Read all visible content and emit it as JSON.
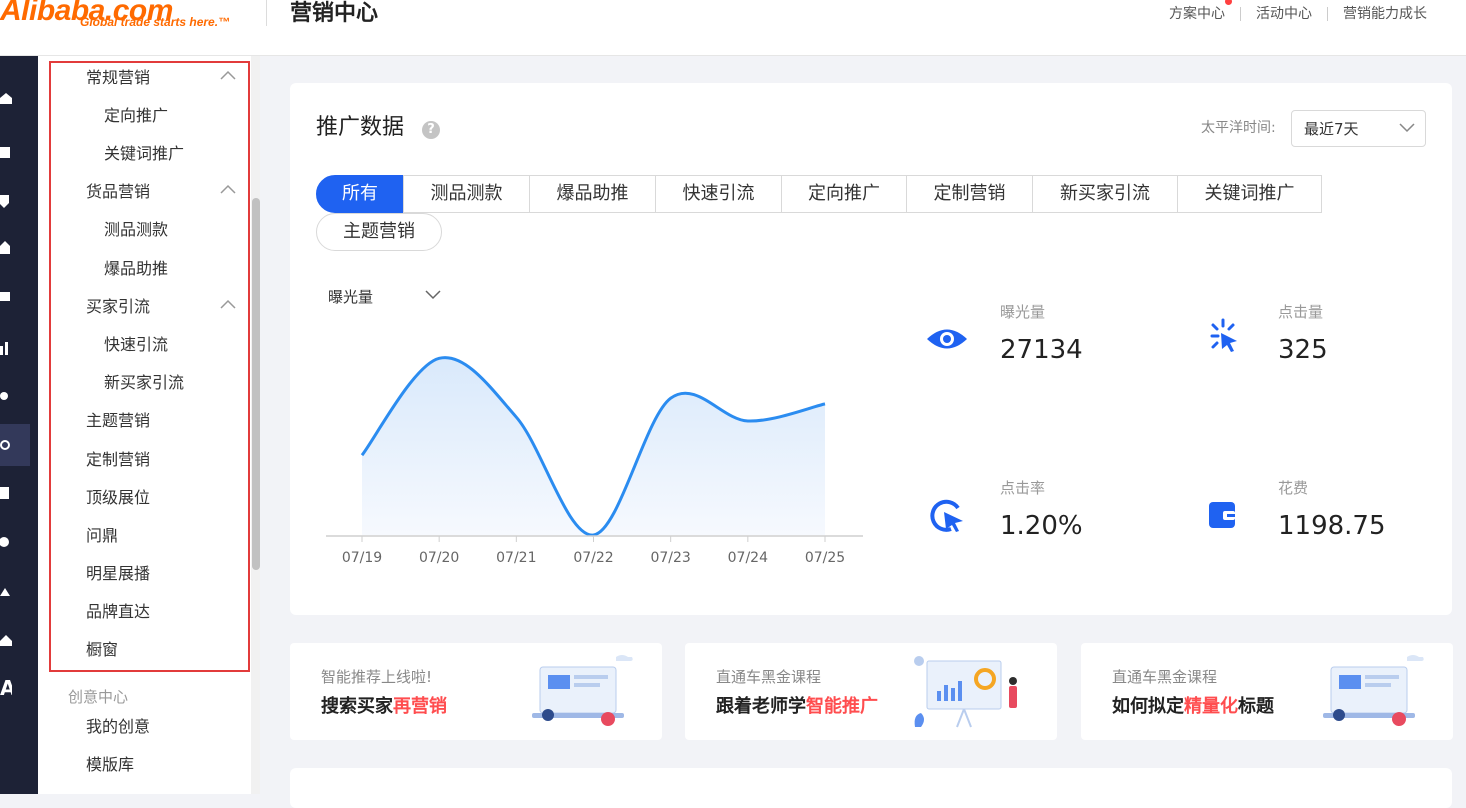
{
  "header": {
    "logo_text": "Alibaba.com",
    "logo_registered": "®",
    "logo_tagline": "Global trade starts here.™",
    "title": "营销中心",
    "nav": [
      "方案中心",
      "活动中心",
      "营销能力成长"
    ]
  },
  "sidebar": {
    "sections": [
      {
        "label": "常规营销",
        "expanded": true,
        "children": [
          "定向推广",
          "关键词推广"
        ]
      },
      {
        "label": "货品营销",
        "expanded": true,
        "children": [
          "测品测款",
          "爆品助推"
        ]
      },
      {
        "label": "买家引流",
        "expanded": true,
        "children": [
          "快速引流",
          "新买家引流"
        ]
      }
    ],
    "items": [
      "主题营销",
      "定制营销",
      "顶级展位",
      "问鼎",
      "明星展播",
      "品牌直达",
      "橱窗"
    ],
    "group_label": "创意中心",
    "group_items": [
      "我的创意",
      "模版库"
    ]
  },
  "panel": {
    "title": "推广数据",
    "help_glyph": "?",
    "timezone_label": "太平洋时间:",
    "range_value": "最近7天",
    "tabs": [
      "所有",
      "测品测款",
      "爆品助推",
      "快速引流",
      "定向推广",
      "定制营销",
      "新买家引流",
      "关键词推广",
      "主题营销"
    ],
    "active_tab": "所有",
    "metric_select": "曝光量"
  },
  "stats": [
    {
      "label": "曝光量",
      "value": "27134",
      "icon": "eye-icon"
    },
    {
      "label": "点击量",
      "value": "325",
      "icon": "click-burst-icon"
    },
    {
      "label": "点击率",
      "value": "1.20%",
      "icon": "cursor-circle-icon"
    },
    {
      "label": "花费",
      "value": "1198.75",
      "icon": "wallet-icon"
    }
  ],
  "chart_data": {
    "type": "area",
    "x": [
      "07/19",
      "07/20",
      "07/21",
      "07/22",
      "07/23",
      "07/24",
      "07/25"
    ],
    "series": [
      {
        "values": [
          0.42,
          0.93,
          0.62,
          0.0,
          0.72,
          0.6,
          0.69
        ]
      }
    ],
    "color": "#2b8cf0",
    "fill": "#e8f2fc",
    "grid": false
  },
  "banners": [
    {
      "sub": "智能推荐上线啦!",
      "main_before": "搜索买家",
      "main_highlight": "再营销",
      "main_after": ""
    },
    {
      "sub": "直通车黑金课程",
      "main_before": "跟着老师学",
      "main_highlight": "智能推广",
      "main_after": ""
    },
    {
      "sub": "直通车黑金课程",
      "main_before": "如何拟定",
      "main_highlight": "精量化",
      "main_after": "标题"
    }
  ],
  "colors": {
    "brand": "#ff6a00",
    "accent": "#1f62f1",
    "highlight_border": "#e23b3b",
    "rail": "#1d2236"
  }
}
